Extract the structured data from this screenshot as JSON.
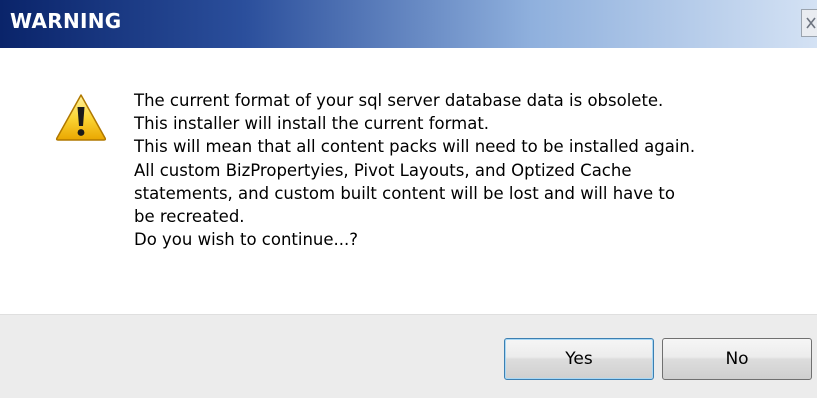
{
  "window": {
    "title": "WARNING",
    "close_icon": "close-icon",
    "title_gradient": [
      "#0a246a",
      "#2b4f9c",
      "#8fb0dd",
      "#d4e2f4"
    ]
  },
  "message": {
    "icon": "warning-icon",
    "lines": [
      "The current format of your sql server database data is obsolete.",
      "This installer will install the current format.",
      "This will mean that all content packs will need to be installed again.",
      "All custom BizPropertyies, Pivot Layouts, and Optized Cache",
      "statements, and custom built content will be lost and will have to",
      "be recreated.",
      "Do you wish to continue...?"
    ]
  },
  "buttons": {
    "yes_label": "Yes",
    "no_label": "No"
  }
}
